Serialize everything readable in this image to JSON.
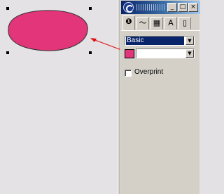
{
  "canvas": {
    "ellipse_fill": "#e2357a",
    "handle_color": "#000000",
    "arrow_color": "#e01010"
  },
  "panel": {
    "titlebar_colors": [
      "#0a246a",
      "#a6caf0"
    ],
    "window_buttons": {
      "minimize": "_",
      "maximize": "□",
      "close": "×"
    },
    "tabs": [
      {
        "icon": "fill-icon",
        "glyph": "❶",
        "active": true
      },
      {
        "icon": "stroke-icon",
        "glyph": "〜",
        "active": false
      },
      {
        "icon": "gradient-icon",
        "glyph": "▦",
        "active": false
      },
      {
        "icon": "text-icon",
        "glyph": "A",
        "active": false
      },
      {
        "icon": "page-icon",
        "glyph": "▯",
        "active": false
      }
    ],
    "fill_type": {
      "value": "Basic"
    },
    "color": {
      "swatch": "#e2357a",
      "value": ""
    },
    "overprint": {
      "label": "Overprint",
      "checked": false
    }
  }
}
